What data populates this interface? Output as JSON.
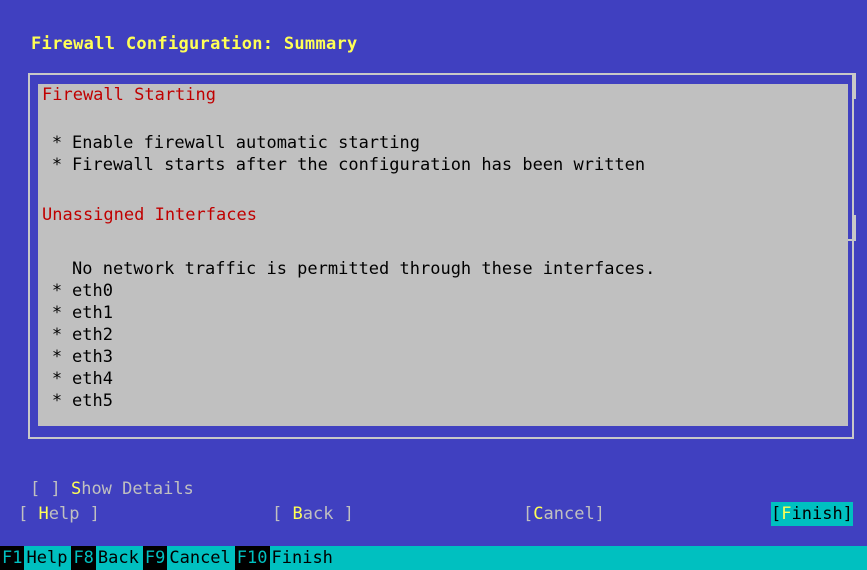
{
  "title": "Firewall Configuration: Summary",
  "summary": {
    "section1": {
      "heading": "Firewall Starting",
      "items": [
        "Enable firewall automatic starting",
        "Firewall starts after the configuration has been written"
      ]
    },
    "section2": {
      "heading": "Unassigned Interfaces",
      "note": "No network traffic is permitted through these interfaces.",
      "items": [
        "eth0",
        "eth1",
        "eth2",
        "eth3",
        "eth4",
        "eth5"
      ]
    },
    "bullet": "*"
  },
  "show_details": {
    "open": "[ ] ",
    "hotkey": "S",
    "rest": "how Details"
  },
  "buttons": {
    "help": {
      "pre": "[ ",
      "hotkey": "H",
      "rest": "elp ]"
    },
    "back": {
      "pre": "[ ",
      "hotkey": "B",
      "rest": "ack ]"
    },
    "cancel": {
      "pre": "[",
      "hotkey": "C",
      "rest": "ancel]"
    },
    "finish": {
      "pre": "[",
      "hotkey": "F",
      "rest": "inish]"
    }
  },
  "fkeys": [
    {
      "key": "F1",
      "label": "Help"
    },
    {
      "key": "F8",
      "label": "Back"
    },
    {
      "key": "F9",
      "label": "Cancel"
    },
    {
      "key": "F10",
      "label": "Finish"
    }
  ],
  "colors": {
    "background": "#4040c0",
    "title": "#ffff55",
    "panel": "#c0c0c0",
    "heading": "#c00000",
    "statusbar": "#00c0c0"
  }
}
